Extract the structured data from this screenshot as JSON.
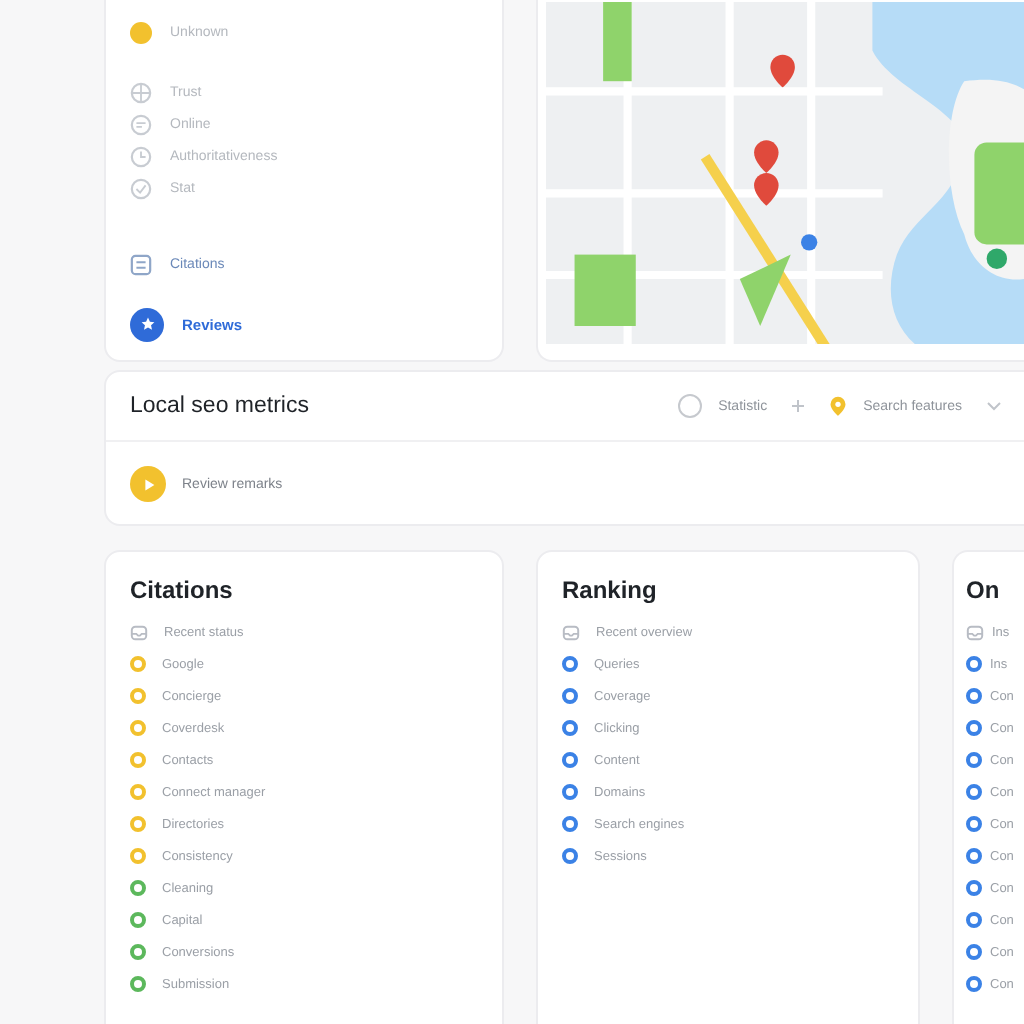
{
  "overview": {
    "top_item": {
      "label": "Unknown",
      "color": "#f2c12e"
    },
    "items": [
      {
        "label": "Trust",
        "kind": "globe"
      },
      {
        "label": "Online",
        "kind": "chat"
      },
      {
        "label": "Authoritativeness",
        "kind": "clock"
      },
      {
        "label": "Stat",
        "kind": "check"
      }
    ],
    "section": {
      "label": "Citations"
    },
    "active": {
      "label": "Reviews",
      "selected": true
    }
  },
  "metrics": {
    "title": "Local seo metrics",
    "filters": [
      {
        "label": "Statistic",
        "kind": "radio",
        "selected": false
      },
      {
        "label": "Search features",
        "kind": "pin"
      }
    ],
    "row": {
      "label": "Review remarks"
    }
  },
  "panels": [
    {
      "title": "Citations",
      "items": [
        {
          "label": "Recent status",
          "kind": "header"
        },
        {
          "label": "Google",
          "kind": "dot",
          "color": "#f2c12e"
        },
        {
          "label": "Concierge",
          "kind": "dot",
          "color": "#f2c12e"
        },
        {
          "label": "Coverdesk",
          "kind": "dot",
          "color": "#f2c12e"
        },
        {
          "label": "Contacts",
          "kind": "dot",
          "color": "#f2c12e"
        },
        {
          "label": "Connect manager",
          "kind": "dot",
          "color": "#f2c12e"
        },
        {
          "label": "Directories",
          "kind": "dot",
          "color": "#f2c12e"
        },
        {
          "label": "Consistency",
          "kind": "dot",
          "color": "#f2c12e"
        },
        {
          "label": "Cleaning",
          "kind": "dot",
          "color": "#5cb85c"
        },
        {
          "label": "Capital",
          "kind": "dot",
          "color": "#5cb85c"
        },
        {
          "label": "Conversions",
          "kind": "dot",
          "color": "#5cb85c"
        },
        {
          "label": "Submission",
          "kind": "dot",
          "color": "#5cb85c"
        }
      ]
    },
    {
      "title": "Ranking",
      "items": [
        {
          "label": "Recent overview",
          "kind": "header"
        },
        {
          "label": "Queries",
          "kind": "dot",
          "color": "#3b82e6"
        },
        {
          "label": "Coverage",
          "kind": "dot",
          "color": "#3b82e6"
        },
        {
          "label": "Clicking",
          "kind": "dot",
          "color": "#3b82e6"
        },
        {
          "label": "Content",
          "kind": "dot",
          "color": "#3b82e6"
        },
        {
          "label": "Domains",
          "kind": "dot",
          "color": "#3b82e6"
        },
        {
          "label": "Search engines",
          "kind": "dot",
          "color": "#3b82e6"
        },
        {
          "label": "Sessions",
          "kind": "dot",
          "color": "#3b82e6"
        }
      ]
    },
    {
      "title": "On",
      "items": [
        {
          "label": "Ins",
          "kind": "header"
        },
        {
          "label": "Ins",
          "kind": "dot",
          "color": "#3b82e6"
        },
        {
          "label": "Con",
          "kind": "dot",
          "color": "#3b82e6"
        },
        {
          "label": "Con",
          "kind": "dot",
          "color": "#3b82e6"
        },
        {
          "label": "Con",
          "kind": "dot",
          "color": "#3b82e6"
        },
        {
          "label": "Con",
          "kind": "dot",
          "color": "#3b82e6"
        },
        {
          "label": "Con",
          "kind": "dot",
          "color": "#3b82e6"
        },
        {
          "label": "Con",
          "kind": "dot",
          "color": "#3b82e6"
        },
        {
          "label": "Con",
          "kind": "dot",
          "color": "#3b82e6"
        },
        {
          "label": "Con",
          "kind": "dot",
          "color": "#3b82e6"
        },
        {
          "label": "Con",
          "kind": "dot",
          "color": "#3b82e6"
        },
        {
          "label": "Con",
          "kind": "dot",
          "color": "#3b82e6"
        }
      ]
    }
  ]
}
